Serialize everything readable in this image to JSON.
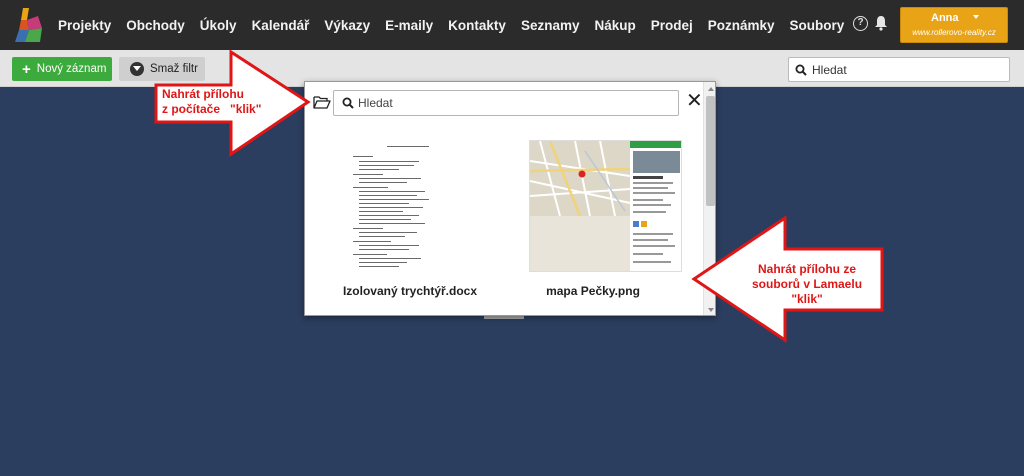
{
  "nav": {
    "items": [
      "Projekty",
      "Obchody",
      "Úkoly",
      "Kalendář",
      "Výkazy",
      "E-maily",
      "Kontakty",
      "Seznamy",
      "Nákup",
      "Prodej",
      "Poznámky",
      "Soubory"
    ]
  },
  "user": {
    "name": "Anna",
    "domain": "www.rollerovo-reality.cz"
  },
  "toolbar": {
    "new_label": "Nový záznam",
    "filter_label": "Smaž filtr"
  },
  "top_search": {
    "placeholder": "Hledat"
  },
  "modal": {
    "search_placeholder": "Hledat",
    "close_glyph": "✕",
    "files": [
      {
        "name": "Izolovaný trychtýř.docx",
        "kind": "docx"
      },
      {
        "name": "mapa Pečky.png",
        "kind": "png"
      }
    ]
  },
  "annotations": {
    "left": "Nahrát přílohu\nz počítače   \"klik\"",
    "right": "Nahrát přílohu ze\nsouborů v Lamaelu\n\"klik\""
  },
  "colors": {
    "accent_green": "#3caa3c",
    "user_orange": "#e8a317",
    "annotation_red": "#e01616",
    "background_navy": "#2c3e5f"
  },
  "icons": [
    "logo-icon",
    "help-icon",
    "bell-icon",
    "plus-icon",
    "filter-icon",
    "search-icon",
    "folder-open-icon",
    "close-icon",
    "caret-down-icon"
  ]
}
